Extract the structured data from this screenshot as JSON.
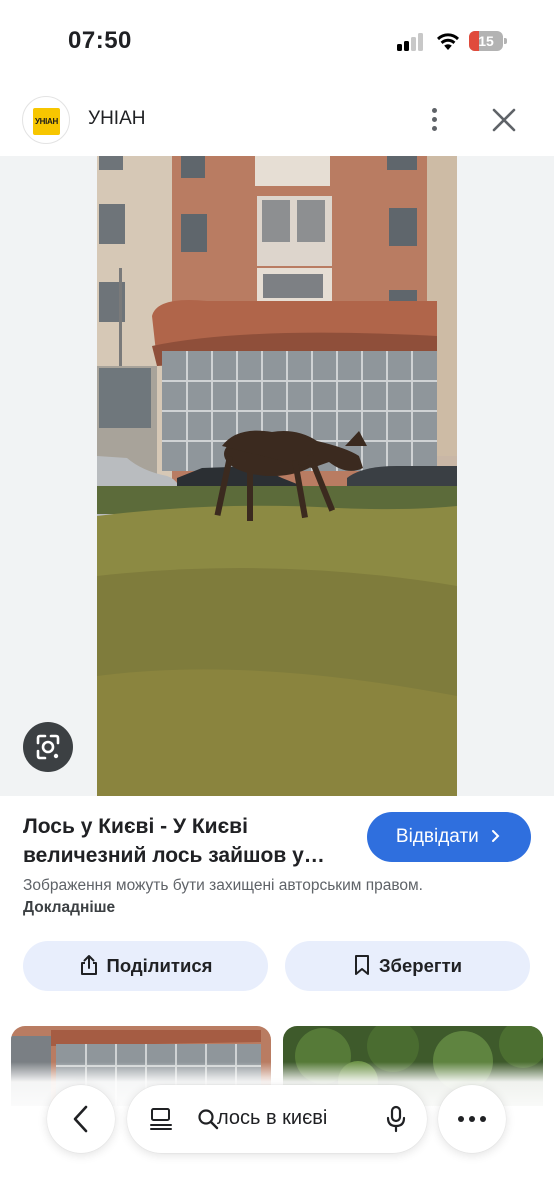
{
  "status_bar": {
    "time": "07:50",
    "battery": "15"
  },
  "header": {
    "site_name": "УНІАН",
    "logo_text": "УНІАН"
  },
  "result": {
    "title_line1": "Лось у Києві - У Києві",
    "title_line2": "величезний лось зайшов у…",
    "visit_label": "Відвідати",
    "copyright_text": "Зображення можуть бути захищені авторським правом.",
    "learn_more": "Докладніше"
  },
  "actions": {
    "share_label": "Поділитися",
    "save_label": "Зберегти"
  },
  "bottom_bar": {
    "query": "лось в києві"
  },
  "colors": {
    "accent": "#2f6fde",
    "action_bg": "#e8eefc",
    "logo_yellow": "#f7c600"
  }
}
